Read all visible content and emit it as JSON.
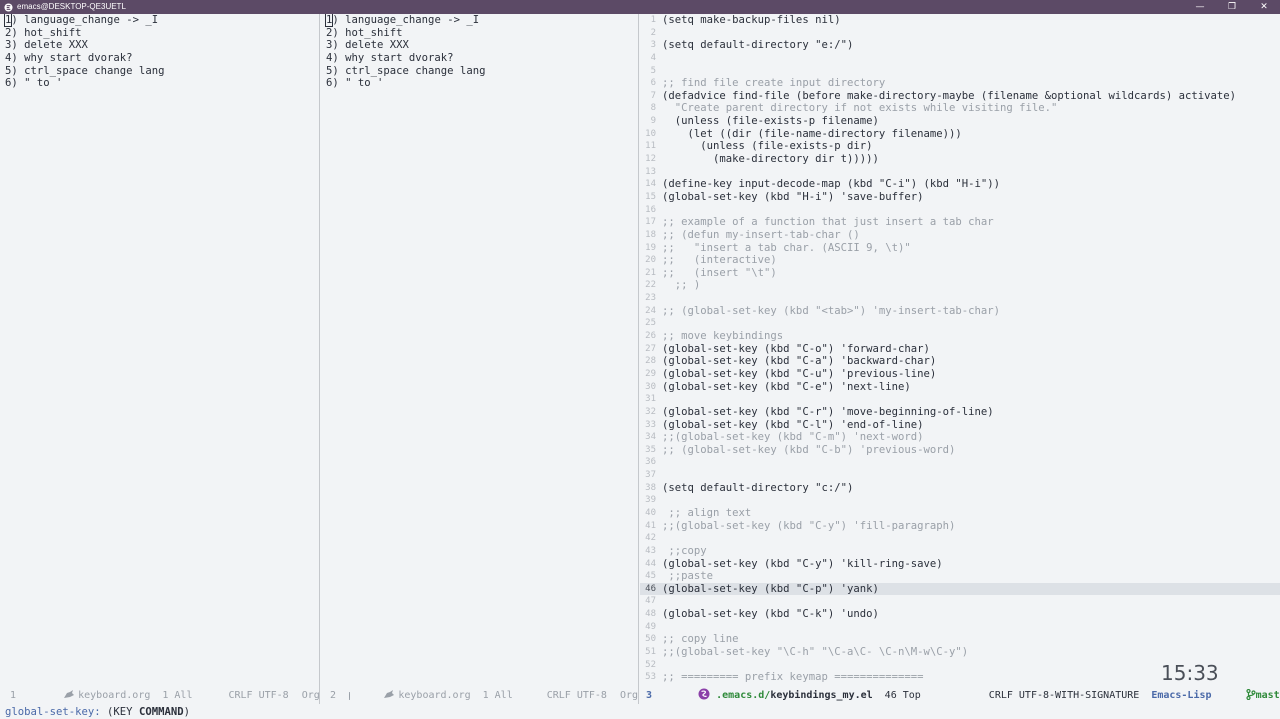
{
  "titlebar": {
    "title": "emacs@DESKTOP-QE3UETL",
    "minimize": "—",
    "maximize": "❐",
    "close": "✕"
  },
  "org_buffer": {
    "lines": [
      "1) language_change -> _I",
      "2) hot_shift",
      "3) delete XXX",
      "4) why start dvorak?",
      "5) ctrl_space change lang",
      "6) \" to '"
    ]
  },
  "code_buffer": {
    "lines": [
      {
        "n": "1",
        "text": "(setq make-backup-files nil)",
        "comment": false
      },
      {
        "n": "2",
        "text": "",
        "comment": false
      },
      {
        "n": "3",
        "text": "(setq default-directory \"e:/\")",
        "comment": false
      },
      {
        "n": "4",
        "text": "",
        "comment": false
      },
      {
        "n": "5",
        "text": "",
        "comment": false
      },
      {
        "n": "6",
        "text": ";; find file create input directory",
        "comment": true
      },
      {
        "n": "7",
        "text": "(defadvice find-file (before make-directory-maybe (filename &optional wildcards) activate)",
        "comment": false
      },
      {
        "n": "8",
        "text": "  \"Create parent directory if not exists while visiting file.\"",
        "comment": true
      },
      {
        "n": "9",
        "text": "  (unless (file-exists-p filename)",
        "comment": false
      },
      {
        "n": "10",
        "text": "    (let ((dir (file-name-directory filename)))",
        "comment": false
      },
      {
        "n": "11",
        "text": "      (unless (file-exists-p dir)",
        "comment": false
      },
      {
        "n": "12",
        "text": "        (make-directory dir t)))))",
        "comment": false
      },
      {
        "n": "13",
        "text": "",
        "comment": false
      },
      {
        "n": "14",
        "text": "(define-key input-decode-map (kbd \"C-i\") (kbd \"H-i\"))",
        "comment": false
      },
      {
        "n": "15",
        "text": "(global-set-key (kbd \"H-i\") 'save-buffer)",
        "comment": false
      },
      {
        "n": "16",
        "text": "",
        "comment": false
      },
      {
        "n": "17",
        "text": ";; example of a function that just insert a tab char",
        "comment": true
      },
      {
        "n": "18",
        "text": ";; (defun my-insert-tab-char ()",
        "comment": true
      },
      {
        "n": "19",
        "text": ";;   \"insert a tab char. (ASCII 9, \\t)\"",
        "comment": true
      },
      {
        "n": "20",
        "text": ";;   (interactive)",
        "comment": true
      },
      {
        "n": "21",
        "text": ";;   (insert \"\\t\")",
        "comment": true
      },
      {
        "n": "22",
        "text": "  ;; )",
        "comment": true
      },
      {
        "n": "23",
        "text": "",
        "comment": false
      },
      {
        "n": "24",
        "text": ";; (global-set-key (kbd \"<tab>\") 'my-insert-tab-char)",
        "comment": true
      },
      {
        "n": "25",
        "text": "",
        "comment": false
      },
      {
        "n": "26",
        "text": ";; move keybindings",
        "comment": true
      },
      {
        "n": "27",
        "text": "(global-set-key (kbd \"C-o\") 'forward-char)",
        "comment": false
      },
      {
        "n": "28",
        "text": "(global-set-key (kbd \"C-a\") 'backward-char)",
        "comment": false
      },
      {
        "n": "29",
        "text": "(global-set-key (kbd \"C-u\") 'previous-line)",
        "comment": false
      },
      {
        "n": "30",
        "text": "(global-set-key (kbd \"C-e\") 'next-line)",
        "comment": false
      },
      {
        "n": "31",
        "text": "",
        "comment": false
      },
      {
        "n": "32",
        "text": "(global-set-key (kbd \"C-r\") 'move-beginning-of-line)",
        "comment": false
      },
      {
        "n": "33",
        "text": "(global-set-key (kbd \"C-l\") 'end-of-line)",
        "comment": false
      },
      {
        "n": "34",
        "text": ";;(global-set-key (kbd \"C-m\") 'next-word)",
        "comment": true
      },
      {
        "n": "35",
        "text": ";; (global-set-key (kbd \"C-b\") 'previous-word)",
        "comment": true
      },
      {
        "n": "36",
        "text": "",
        "comment": false
      },
      {
        "n": "37",
        "text": "",
        "comment": false
      },
      {
        "n": "38",
        "text": "(setq default-directory \"c:/\")",
        "comment": false
      },
      {
        "n": "39",
        "text": "",
        "comment": false
      },
      {
        "n": "40",
        "text": " ;; align text",
        "comment": true
      },
      {
        "n": "41",
        "text": ";;(global-set-key (kbd \"C-y\") 'fill-paragraph)",
        "comment": true
      },
      {
        "n": "42",
        "text": "",
        "comment": false
      },
      {
        "n": "43",
        "text": " ;;copy",
        "comment": true
      },
      {
        "n": "44",
        "text": "(global-set-key (kbd \"C-y\") 'kill-ring-save)",
        "comment": false
      },
      {
        "n": "45",
        "text": " ;;paste",
        "comment": true
      },
      {
        "n": "46",
        "text": "(global-set-key (kbd \"C-p\") 'yank)",
        "comment": false
      },
      {
        "n": "47",
        "text": "",
        "comment": false
      },
      {
        "n": "48",
        "text": "(global-set-key (kbd \"C-k\") 'undo)",
        "comment": false
      },
      {
        "n": "49",
        "text": "",
        "comment": false
      },
      {
        "n": "50",
        "text": ";; copy line",
        "comment": true
      },
      {
        "n": "51",
        "text": ";;(global-set-key \"\\C-h\" \"\\C-a\\C- \\C-n\\M-w\\C-y\")",
        "comment": true
      },
      {
        "n": "52",
        "text": "",
        "comment": false
      },
      {
        "n": "53",
        "text": ";; ========= prefix keymap ==============",
        "comment": true
      }
    ],
    "current_line": "46"
  },
  "modeline_1": {
    "window_number": "1",
    "icon": "org-unicorn-icon",
    "buffer_name": "keyboard.org",
    "position": "1 All",
    "encoding": "CRLF UTF-8",
    "mode": "Org"
  },
  "modeline_2": {
    "window_number": "2",
    "icon": "org-unicorn-icon",
    "buffer_name": "keyboard.org",
    "position": "1 All",
    "encoding": "CRLF UTF-8",
    "mode": "Org"
  },
  "modeline_3": {
    "window_number": "3",
    "icon": "emacs-icon",
    "buffer_dir": ".emacs.d/",
    "buffer_name": "keybindings_my.el",
    "position": "46 Top",
    "encoding": "CRLF UTF-8-WITH-SIGNATURE",
    "mode": "Emacs-Lisp",
    "branch": "master",
    "active_color": "#4a69a8",
    "dot_color": "#2f8a3a"
  },
  "minibuffer": {
    "prompt": "global-set-key:",
    "text_open": " (KEY ",
    "key": "COMMAND",
    "text_close": ")"
  },
  "clock": "15:33"
}
